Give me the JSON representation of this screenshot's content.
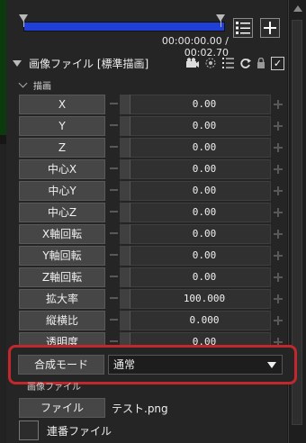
{
  "timeline": {
    "current_time": "00:00:00.00",
    "separator": " / ",
    "total_time": "00:02.70"
  },
  "object": {
    "title": "画像ファイル [標準描画]"
  },
  "sections": {
    "drawing": "描画",
    "image_file": "画像ファイル"
  },
  "params": [
    {
      "label": "X",
      "value": "0.00"
    },
    {
      "label": "Y",
      "value": "0.00"
    },
    {
      "label": "Z",
      "value": "0.00"
    },
    {
      "label": "中心X",
      "value": "0.00"
    },
    {
      "label": "中心Y",
      "value": "0.00"
    },
    {
      "label": "中心Z",
      "value": "0.00"
    },
    {
      "label": "X軸回転",
      "value": "0.00"
    },
    {
      "label": "Y軸回転",
      "value": "0.00"
    },
    {
      "label": "Z軸回転",
      "value": "0.00"
    },
    {
      "label": "拡大率",
      "value": "100.000"
    },
    {
      "label": "縦横比",
      "value": "0.000"
    },
    {
      "label": "透明度",
      "value": "0.00"
    }
  ],
  "blend": {
    "label": "合成モード",
    "value": "通常"
  },
  "file": {
    "button": "ファイル",
    "name": "テスト.png",
    "sequence_label": "連番ファイル"
  },
  "colors": {
    "timeline_bar": "#1f3fd6",
    "highlight": "#c0282d"
  }
}
